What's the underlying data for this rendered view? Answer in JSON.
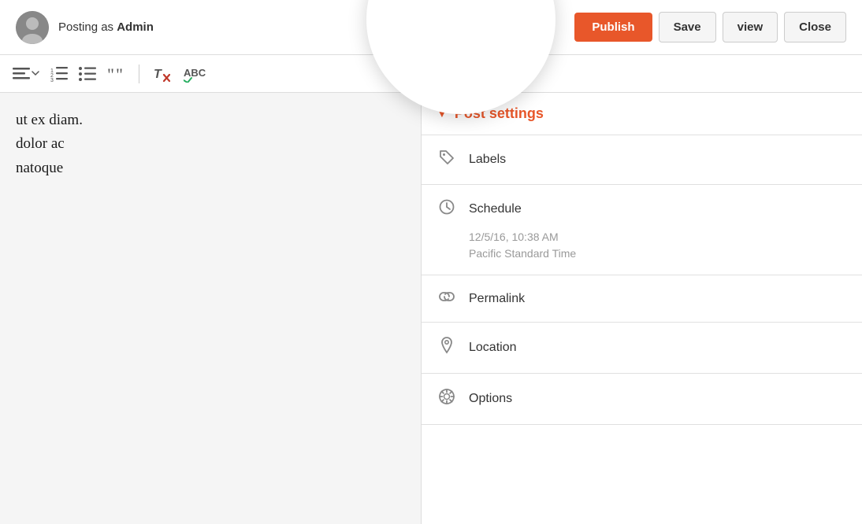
{
  "header": {
    "posting_as_prefix": "Posting as ",
    "user_name": "Admin",
    "publish_label": "Publish",
    "save_label": "Save",
    "preview_label": "view",
    "close_label": "Close"
  },
  "toolbar": {
    "icons": [
      {
        "name": "align-left-icon",
        "symbol": "≡"
      },
      {
        "name": "numbered-list-icon",
        "symbol": "≔"
      },
      {
        "name": "bullet-list-icon",
        "symbol": "☰"
      },
      {
        "name": "blockquote-icon",
        "symbol": "❝"
      },
      {
        "name": "clear-formatting-icon",
        "symbol": "T̶"
      },
      {
        "name": "spell-check-icon",
        "symbol": "ABC"
      }
    ]
  },
  "editor": {
    "content_line1": "ut ex diam.",
    "content_line2": "dolor ac",
    "content_line3": "natoque"
  },
  "sidebar": {
    "section_title": "Post settings",
    "items": [
      {
        "id": "labels",
        "label": "Labels",
        "icon": "label-icon"
      },
      {
        "id": "schedule",
        "label": "Schedule",
        "icon": "schedule-icon",
        "sub_date": "12/5/16, 10:38 AM",
        "sub_tz": "Pacific Standard Time"
      },
      {
        "id": "permalink",
        "label": "Permalink",
        "icon": "permalink-icon"
      },
      {
        "id": "location",
        "label": "Location",
        "icon": "location-icon"
      },
      {
        "id": "options",
        "label": "Options",
        "icon": "options-icon"
      }
    ]
  }
}
